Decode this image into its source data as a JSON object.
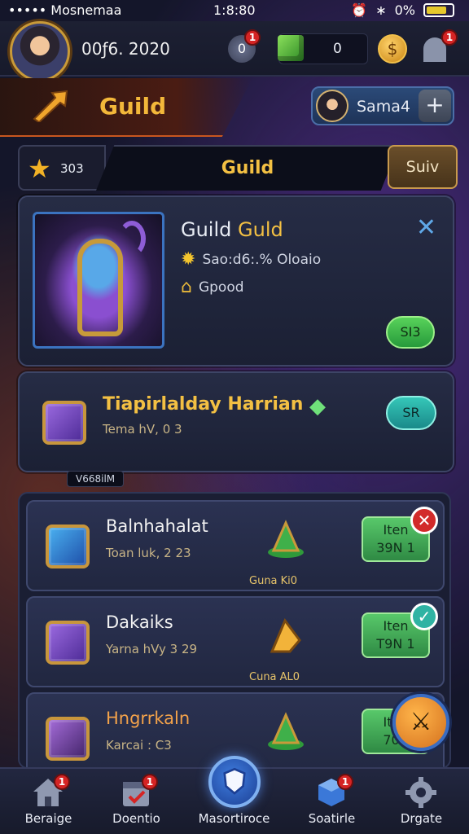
{
  "status_bar": {
    "carrier": "••••• Mosnemaa",
    "time": "1:8:80",
    "battery": "0%"
  },
  "header": {
    "player_id": "00ƒ6. 2020",
    "gem_count": "0",
    "badge_left": "0",
    "notif_count": "1"
  },
  "guild_banner": {
    "title": "Guild",
    "user_name": "Sama4",
    "plus": "+"
  },
  "search": {
    "rank": "303",
    "tab_label": "Guild",
    "button_label": "Suiv"
  },
  "guild_card": {
    "name_part1": "Guild",
    "name_part2": "Guld",
    "subtitle": "Sao:d6:.% Oloaio",
    "detail": "Gpood",
    "button_label": "SI3"
  },
  "quest_card": {
    "title": "Tiapirlalday Harrian",
    "subtitle": "Tema hV, 0 3",
    "button_label": "SR"
  },
  "section_tag": "V668ilM",
  "list_items": [
    {
      "name": "Balnhahalat",
      "sub": "Toan luk, 2 23",
      "reward": "Guna Ki0",
      "button_line1": "Iten",
      "button_line2": "39N 1",
      "badge": "✕"
    },
    {
      "name": "Dakaiks",
      "sub": "Yarna hVy 3 29",
      "reward": "Cuna AL0",
      "button_line1": "Iten",
      "button_line2": "T9N 1",
      "badge": "✓"
    },
    {
      "name": "Hngrrkaln",
      "sub": "Karcai : C3",
      "reward": "",
      "button_line1": "Iten",
      "button_line2": "70V",
      "badge": ""
    }
  ],
  "bottom_nav": [
    {
      "label": "Beraige",
      "badge": "1"
    },
    {
      "label": "Doentio",
      "badge": "1"
    },
    {
      "label": "Masortiroce",
      "badge": ""
    },
    {
      "label": "Soatirle",
      "badge": "1"
    },
    {
      "label": "Drgate",
      "badge": ""
    }
  ],
  "colors": {
    "accent_gold": "#f3c043",
    "button_green": "#58d25a",
    "alert_red": "#d52424",
    "nav_blue": "#3f7ee0"
  },
  "icons": [
    "wifi-icon",
    "alarm-icon",
    "bluetooth-icon",
    "battery-icon",
    "gem-icon",
    "coin-icon",
    "star-icon",
    "close-icon",
    "sun-icon",
    "house-icon",
    "chest-icon",
    "diamond-icon",
    "home-icon",
    "calendar-icon",
    "shield-icon",
    "cube-icon",
    "gear-icon"
  ]
}
